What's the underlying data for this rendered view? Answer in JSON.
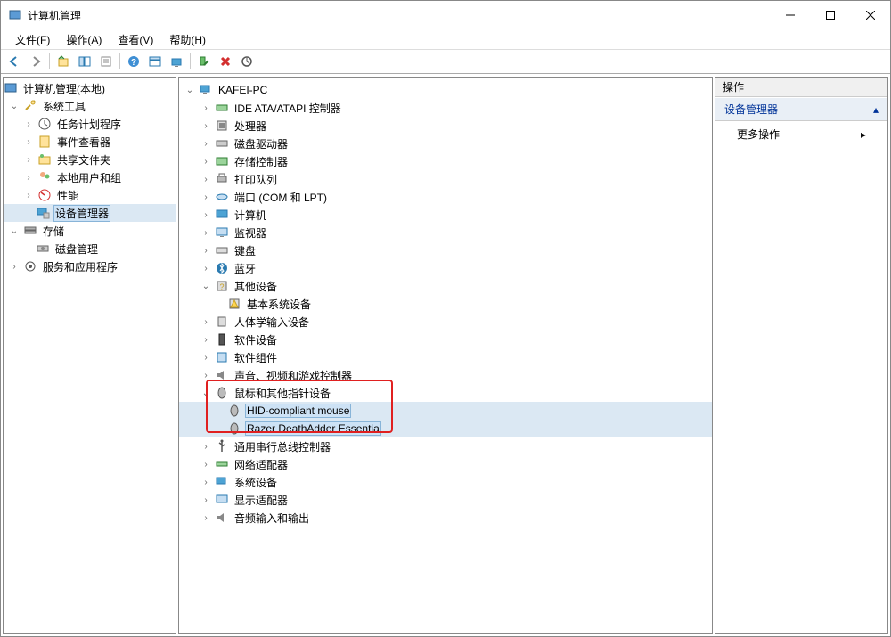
{
  "window": {
    "title": "计算机管理"
  },
  "menu": {
    "file": "文件(F)",
    "action": "操作(A)",
    "view": "查看(V)",
    "help": "帮助(H)"
  },
  "left_tree": {
    "root": "计算机管理(本地)",
    "system_tools": "系统工具",
    "task_scheduler": "任务计划程序",
    "event_viewer": "事件查看器",
    "shared_folders": "共享文件夹",
    "local_users": "本地用户和组",
    "performance": "性能",
    "device_manager": "设备管理器",
    "storage": "存储",
    "disk_mgmt": "磁盘管理",
    "services_apps": "服务和应用程序"
  },
  "mid_tree": {
    "root": "KAFEI-PC",
    "ide": "IDE ATA/ATAPI 控制器",
    "cpu": "处理器",
    "disk_drives": "磁盘驱动器",
    "storage_ctrl": "存储控制器",
    "print_queue": "打印队列",
    "ports": "端口 (COM 和 LPT)",
    "computer": "计算机",
    "monitor": "监视器",
    "keyboard": "键盘",
    "bluetooth": "蓝牙",
    "other_devices": "其他设备",
    "unknown_device": "基本系统设备",
    "hid": "人体学输入设备",
    "software_devices": "软件设备",
    "software_components": "软件组件",
    "sound": "声音、视频和游戏控制器",
    "mouse": "鼠标和其他指针设备",
    "hid_mouse": "HID-compliant mouse",
    "razer": "Razer DeathAdder Essentia",
    "usb": "通用串行总线控制器",
    "network": "网络适配器",
    "system_devices": "系统设备",
    "display": "显示适配器",
    "audio_io": "音频输入和输出"
  },
  "right": {
    "header": "操作",
    "group": "设备管理器",
    "more": "更多操作"
  }
}
